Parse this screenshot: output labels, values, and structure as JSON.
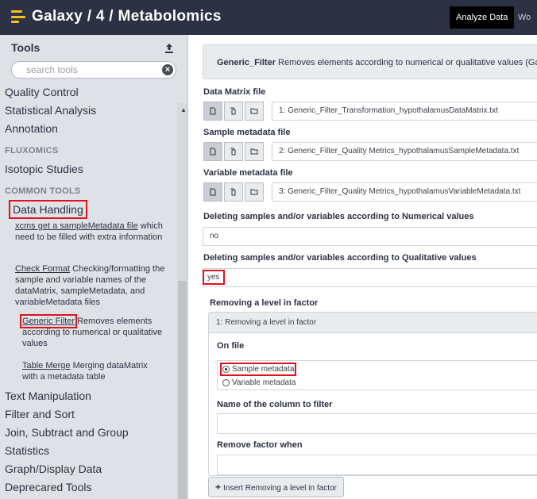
{
  "app": {
    "title": "Galaxy / 4 / Metabolomics",
    "nav_active": "Analyze Data",
    "nav_next": "Wo"
  },
  "sidebar": {
    "title": "Tools",
    "search_placeholder": "search tools",
    "sections_top": [
      "Quality Control",
      "Statistical Analysis",
      "Annotation"
    ],
    "label_fluxomics": "FLUXOMICS",
    "isotopic": "Isotopic Studies",
    "label_common": "COMMON TOOLS",
    "data_handling": "Data Handling",
    "tools": [
      {
        "link": "xcms get a sampleMetadata file",
        "desc": "which need to be filled with extra information"
      },
      {
        "link": "Check Format",
        "desc": "Checking/formatting the sample and variable names of the dataMatrix, sampleMetadata, and variableMetadata files"
      },
      {
        "link": "Generic Filter",
        "desc": "Removes elements according to numerical or qualitative values"
      },
      {
        "link": "Table Merge",
        "desc": "Merging dataMatrix with a metadata table"
      }
    ],
    "sections_bottom": [
      "Text Manipulation",
      "Filter and Sort",
      "Join, Subtract and Group",
      "Statistics",
      "Graph/Display Data",
      "Deprecared Tools"
    ]
  },
  "form": {
    "tool_name": "Generic_Filter",
    "tool_desc": "Removes elements according to numerical or qualitative values (Galaxy V",
    "data_matrix_label": "Data Matrix file",
    "data_matrix_value": "1: Generic_Filter_Transformation_hypothalamusDataMatrix.txt",
    "sample_meta_label": "Sample metadata file",
    "sample_meta_value": "2: Generic_Filter_Quality Metrics_hypothalamusSampleMetadata.txt",
    "variable_meta_label": "Variable metadata file",
    "variable_meta_value": "3: Generic_Filter_Quality Metrics_hypothalamusVariableMetadata.txt",
    "numerical_label": "Deleting samples and/or variables according to Numerical values",
    "numerical_value": "no",
    "qualitative_label": "Deleting samples and/or variables according to Qualitative values",
    "qualitative_value": "yes",
    "repeat_title": "Removing a level in factor",
    "repeat_item": "1: Removing a level in factor",
    "on_file_label": "On file",
    "radio_sample": "Sample metadata",
    "radio_variable": "Variable metadata",
    "column_label": "Name of the column to filter",
    "remove_label": "Remove factor when",
    "insert_button": "Insert Removing a level in factor"
  },
  "colors": {
    "topbar": "#2c3143",
    "sidebar": "#dee2e6",
    "highlight": "#e0111a",
    "brand_icon": "#f5c21a"
  }
}
